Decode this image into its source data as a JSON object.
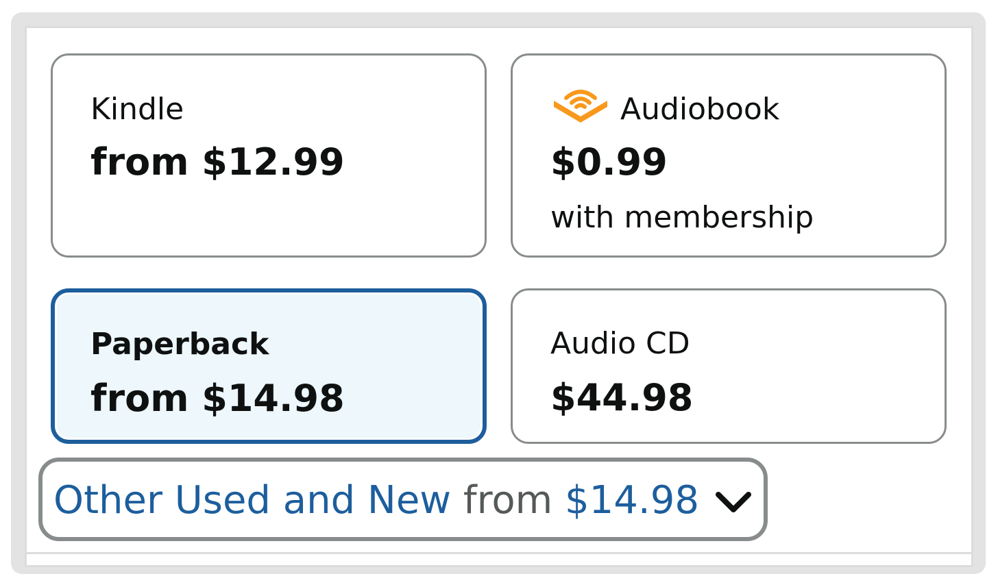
{
  "formats": [
    {
      "title": "Kindle",
      "price": "from $12.99",
      "note": "",
      "selected": false
    },
    {
      "title": "Audiobook",
      "price": "$0.99",
      "note": "with membership",
      "selected": false,
      "icon": "audible-icon"
    },
    {
      "title": "Paperback",
      "price": "from $14.98",
      "note": "",
      "selected": true
    },
    {
      "title": "Audio CD",
      "price": "$44.98",
      "note": "",
      "selected": false
    }
  ],
  "other": {
    "link_text": "Other Used and New",
    "from_text": "from",
    "price": "$14.98",
    "icon": "chevron-down-icon"
  },
  "colors": {
    "selected_border": "#1d5e9d",
    "selected_background": "#edf7fc",
    "link": "#1d5e9d",
    "card_border": "#888c8c",
    "audible_orange": "#f8991d"
  }
}
